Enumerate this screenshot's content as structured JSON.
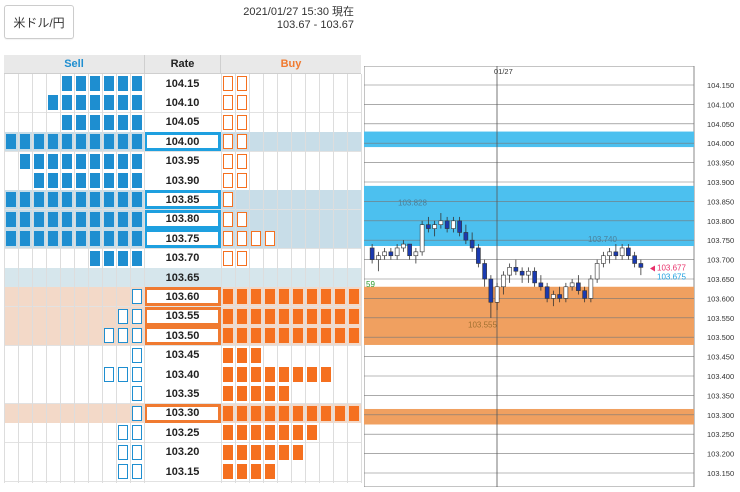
{
  "pair_button": "米ドル/円",
  "timestamp": "2021/01/27 15:30 現在",
  "quote": "103.67 - 103.67",
  "book": {
    "sell_header": "Sell",
    "rate_header": "Rate",
    "buy_header": "Buy",
    "rows": [
      {
        "rate": "104.15",
        "sell": 6,
        "sell_empty": 0,
        "buy": 0,
        "buy_empty": 2,
        "row_bg": "#fff",
        "box": ""
      },
      {
        "rate": "104.10",
        "sell": 7,
        "sell_empty": 0,
        "buy": 0,
        "buy_empty": 2,
        "row_bg": "#fff",
        "box": ""
      },
      {
        "rate": "104.05",
        "sell": 6,
        "sell_empty": 0,
        "buy": 0,
        "buy_empty": 2,
        "row_bg": "#fff",
        "box": ""
      },
      {
        "rate": "104.00",
        "sell": 10,
        "sell_empty": 0,
        "buy": 0,
        "buy_empty": 2,
        "row_bg": "#c8dde8",
        "box": "blue"
      },
      {
        "rate": "103.95",
        "sell": 9,
        "sell_empty": 0,
        "buy": 0,
        "buy_empty": 2,
        "row_bg": "#fff",
        "box": ""
      },
      {
        "rate": "103.90",
        "sell": 8,
        "sell_empty": 0,
        "buy": 0,
        "buy_empty": 2,
        "row_bg": "#fff",
        "box": ""
      },
      {
        "rate": "103.85",
        "sell": 10,
        "sell_empty": 0,
        "buy": 0,
        "buy_empty": 1,
        "row_bg": "#c8dde8",
        "box": "blue"
      },
      {
        "rate": "103.80",
        "sell": 10,
        "sell_empty": 0,
        "buy": 0,
        "buy_empty": 2,
        "row_bg": "#c8dde8",
        "box": "blue"
      },
      {
        "rate": "103.75",
        "sell": 10,
        "sell_empty": 0,
        "buy": 0,
        "buy_empty": 4,
        "row_bg": "#c8dde8",
        "box": "blue"
      },
      {
        "rate": "103.70",
        "sell": 4,
        "sell_empty": 0,
        "buy": 0,
        "buy_empty": 2,
        "row_bg": "#fff",
        "box": ""
      },
      {
        "rate": "103.65",
        "sell": 0,
        "sell_empty": 0,
        "buy": 0,
        "buy_empty": 0,
        "row_bg": "#d6e6ec",
        "box": ""
      },
      {
        "rate": "103.60",
        "sell": 0,
        "sell_empty": 1,
        "buy": 10,
        "buy_empty": 0,
        "row_bg": "#f3d9c8",
        "box": "orange"
      },
      {
        "rate": "103.55",
        "sell": 0,
        "sell_empty": 2,
        "buy": 10,
        "buy_empty": 0,
        "row_bg": "#f3d9c8",
        "box": "orange"
      },
      {
        "rate": "103.50",
        "sell": 0,
        "sell_empty": 3,
        "buy": 10,
        "buy_empty": 0,
        "row_bg": "#f3d9c8",
        "box": "orange"
      },
      {
        "rate": "103.45",
        "sell": 0,
        "sell_empty": 1,
        "buy": 3,
        "buy_empty": 0,
        "row_bg": "#fff",
        "box": ""
      },
      {
        "rate": "103.40",
        "sell": 0,
        "sell_empty": 3,
        "buy": 8,
        "buy_empty": 0,
        "row_bg": "#fff",
        "box": ""
      },
      {
        "rate": "103.35",
        "sell": 0,
        "sell_empty": 1,
        "buy": 5,
        "buy_empty": 0,
        "row_bg": "#fff",
        "box": ""
      },
      {
        "rate": "103.30",
        "sell": 0,
        "sell_empty": 1,
        "buy": 10,
        "buy_empty": 0,
        "row_bg": "#f3d9c8",
        "box": "orange"
      },
      {
        "rate": "103.25",
        "sell": 0,
        "sell_empty": 2,
        "buy": 7,
        "buy_empty": 0,
        "row_bg": "#fff",
        "box": ""
      },
      {
        "rate": "103.20",
        "sell": 0,
        "sell_empty": 2,
        "buy": 6,
        "buy_empty": 0,
        "row_bg": "#fff",
        "box": ""
      },
      {
        "rate": "103.15",
        "sell": 0,
        "sell_empty": 2,
        "buy": 4,
        "buy_empty": 0,
        "row_bg": "#fff",
        "box": ""
      }
    ]
  },
  "chart": {
    "date_label": "01/27",
    "ylabels": [
      "104.150",
      "104.100",
      "104.050",
      "104.000",
      "103.950",
      "103.900",
      "103.850",
      "103.800",
      "103.750",
      "103.700",
      "103.650",
      "103.600",
      "103.550",
      "103.500",
      "103.450",
      "103.400",
      "103.350",
      "103.300",
      "103.250",
      "103.200",
      "103.150"
    ],
    "high_label": "103.828",
    "mid_label": "103.740",
    "low_label": "103.555",
    "left_label": "59",
    "bid_label": "103.677",
    "ask_label": "103.675",
    "sell_zones": [
      [
        103.99,
        104.03
      ],
      [
        103.735,
        103.89
      ]
    ],
    "buy_zones": [
      [
        103.48,
        103.63
      ],
      [
        103.275,
        103.315
      ]
    ],
    "colors": {
      "sell_zone": "#4cc0ef",
      "buy_zone": "#f0a060",
      "up": "#ffffff",
      "down": "#1a3ab0",
      "bid": "#e8306a",
      "ask": "#1ea0e0"
    },
    "candles": [
      [
        103.73,
        103.74,
        103.69,
        103.7
      ],
      [
        103.7,
        103.72,
        103.67,
        103.71
      ],
      [
        103.71,
        103.73,
        103.7,
        103.72
      ],
      [
        103.72,
        103.73,
        103.7,
        103.71
      ],
      [
        103.71,
        103.74,
        103.7,
        103.73
      ],
      [
        103.73,
        103.75,
        103.72,
        103.74
      ],
      [
        103.74,
        103.74,
        103.7,
        103.71
      ],
      [
        103.71,
        103.73,
        103.69,
        103.72
      ],
      [
        103.72,
        103.8,
        103.71,
        103.79
      ],
      [
        103.79,
        103.81,
        103.77,
        103.78
      ],
      [
        103.78,
        103.8,
        103.76,
        103.79
      ],
      [
        103.79,
        103.82,
        103.78,
        103.8
      ],
      [
        103.8,
        103.81,
        103.77,
        103.78
      ],
      [
        103.78,
        103.81,
        103.77,
        103.8
      ],
      [
        103.8,
        103.81,
        103.76,
        103.77
      ],
      [
        103.77,
        103.79,
        103.74,
        103.75
      ],
      [
        103.75,
        103.77,
        103.72,
        103.73
      ],
      [
        103.73,
        103.74,
        103.68,
        103.69
      ],
      [
        103.69,
        103.7,
        103.63,
        103.65
      ],
      [
        103.65,
        103.66,
        103.55,
        103.59
      ],
      [
        103.59,
        103.64,
        103.57,
        103.63
      ],
      [
        103.63,
        103.67,
        103.61,
        103.66
      ],
      [
        103.66,
        103.69,
        103.64,
        103.68
      ],
      [
        103.68,
        103.7,
        103.66,
        103.67
      ],
      [
        103.67,
        103.68,
        103.64,
        103.66
      ],
      [
        103.66,
        103.68,
        103.64,
        103.67
      ],
      [
        103.67,
        103.68,
        103.63,
        103.64
      ],
      [
        103.64,
        103.66,
        103.62,
        103.63
      ],
      [
        103.63,
        103.64,
        103.59,
        103.6
      ],
      [
        103.6,
        103.62,
        103.58,
        103.61
      ],
      [
        103.61,
        103.63,
        103.59,
        103.6
      ],
      [
        103.6,
        103.64,
        103.59,
        103.63
      ],
      [
        103.63,
        103.65,
        103.62,
        103.64
      ],
      [
        103.64,
        103.66,
        103.61,
        103.62
      ],
      [
        103.62,
        103.63,
        103.59,
        103.6
      ],
      [
        103.6,
        103.66,
        103.59,
        103.65
      ],
      [
        103.65,
        103.7,
        103.64,
        103.69
      ],
      [
        103.69,
        103.72,
        103.68,
        103.71
      ],
      [
        103.71,
        103.73,
        103.69,
        103.72
      ],
      [
        103.72,
        103.74,
        103.7,
        103.71
      ],
      [
        103.71,
        103.74,
        103.7,
        103.73
      ],
      [
        103.73,
        103.74,
        103.7,
        103.71
      ],
      [
        103.71,
        103.72,
        103.68,
        103.69
      ],
      [
        103.69,
        103.7,
        103.66,
        103.68
      ]
    ]
  }
}
